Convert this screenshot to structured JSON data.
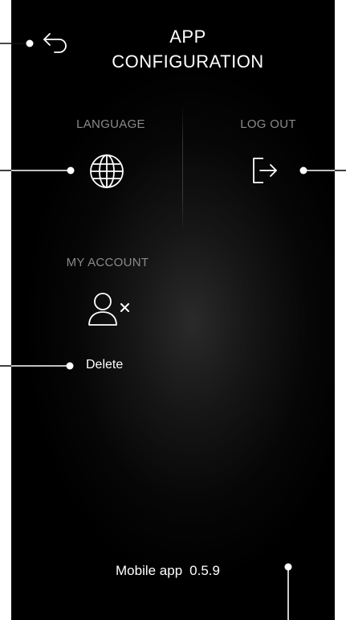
{
  "header": {
    "title_line1": "APP",
    "title_line2": "CONFIGURATION"
  },
  "language": {
    "label": "LANGUAGE",
    "icon": "globe-icon"
  },
  "logout": {
    "label": "LOG OUT",
    "icon": "logout-arrow-icon"
  },
  "account": {
    "label": "MY ACCOUNT",
    "icon": "user-remove-icon",
    "delete_label": "Delete"
  },
  "footer": {
    "app_label": "Mobile app",
    "version": "0.5.9"
  },
  "colors": {
    "background": "#000000",
    "text": "#ffffff",
    "label": "#8a8a8a",
    "callout": "#111111"
  }
}
